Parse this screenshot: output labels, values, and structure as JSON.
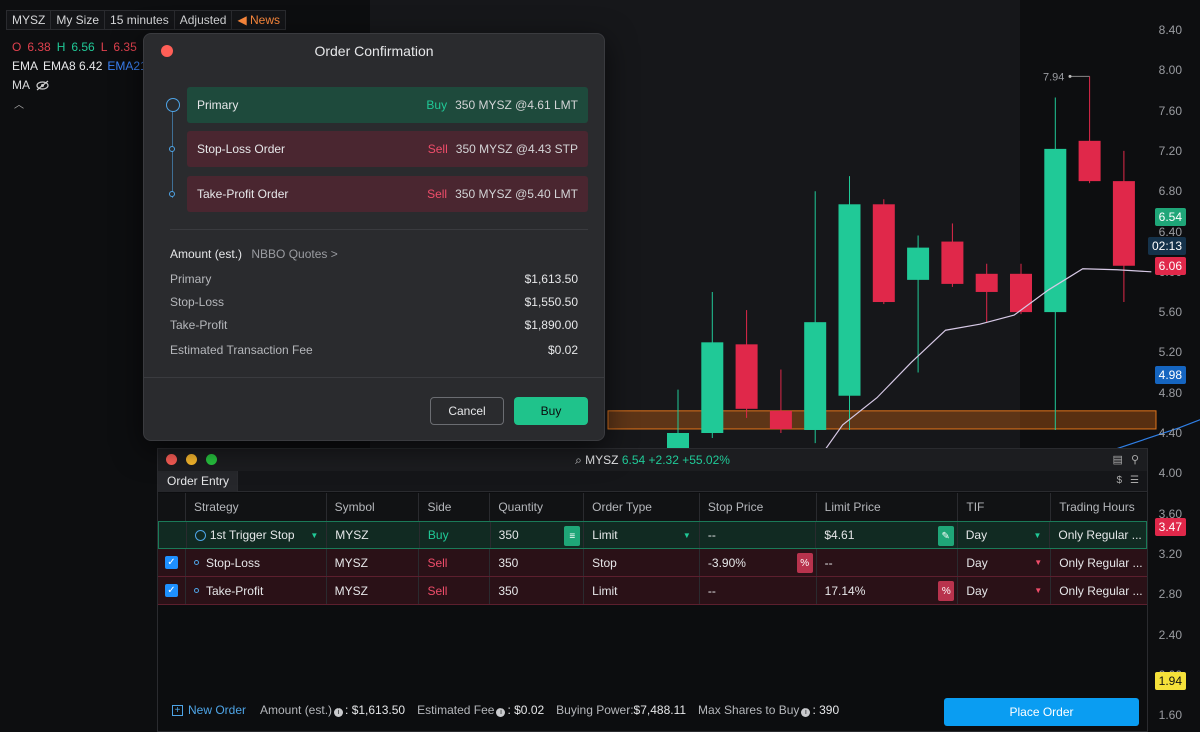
{
  "toolbar": {
    "symbol": "MYSZ",
    "size": "My Size",
    "interval": "15 minutes",
    "adjust": "Adjusted",
    "news": "News"
  },
  "ohlc": {
    "o_label": "O",
    "o": "6.38",
    "h_label": "H",
    "h": "6.56",
    "l_label": "L",
    "l": "6.35"
  },
  "studies": {
    "ema_label": "EMA",
    "ema8": "EMA8 6.42",
    "ema21": "EMA21",
    "ma_label": "MA"
  },
  "colors": {
    "up": "#20c997",
    "down": "#e0284a",
    "accent": "#0a9df2",
    "ema8": "#d7c9e6",
    "ema21": "#2f7fe6"
  },
  "y_axis": {
    "ticks": [
      "8.40",
      "8.00",
      "7.60",
      "7.20",
      "6.80",
      "6.40",
      "6.00",
      "5.60",
      "5.20",
      "4.80",
      "4.40",
      "4.00",
      "3.60",
      "3.20",
      "2.80",
      "2.40",
      "2.00",
      "1.60"
    ],
    "tags": [
      {
        "text": "6.54",
        "bg": "#1fa678",
        "fg": "#ffffff"
      },
      {
        "text": "02:13",
        "bg": "#15324a",
        "fg": "#ffffff"
      },
      {
        "text": "6.06",
        "bg": "#e0284a",
        "fg": "#ffffff"
      },
      {
        "text": "4.98",
        "bg": "#1565c0",
        "fg": "#ffffff"
      },
      {
        "text": "3.47",
        "bg": "#e0284a",
        "fg": "#ffffff"
      },
      {
        "text": "1.94",
        "bg": "#f5e13a",
        "fg": "#111111"
      }
    ],
    "high_marker": "7.94"
  },
  "candles": [
    {
      "o": 3.47,
      "c": 4.4,
      "h": 4.83,
      "l": 3.4
    },
    {
      "o": 4.4,
      "c": 5.3,
      "h": 5.8,
      "l": 4.35
    },
    {
      "o": 5.28,
      "c": 4.64,
      "h": 5.62,
      "l": 4.55
    },
    {
      "o": 4.62,
      "c": 4.44,
      "h": 5.03,
      "l": 4.4
    },
    {
      "o": 4.43,
      "c": 5.5,
      "h": 6.8,
      "l": 4.3
    },
    {
      "o": 4.77,
      "c": 6.67,
      "h": 6.95,
      "l": 4.43
    },
    {
      "o": 6.67,
      "c": 5.7,
      "h": 6.72,
      "l": 5.68
    },
    {
      "o": 5.92,
      "c": 6.24,
      "h": 6.36,
      "l": 5.0
    },
    {
      "o": 6.3,
      "c": 5.88,
      "h": 6.48,
      "l": 5.85
    },
    {
      "o": 5.98,
      "c": 5.8,
      "h": 6.08,
      "l": 5.5
    },
    {
      "o": 5.98,
      "c": 5.6,
      "h": 6.08,
      "l": 5.58
    },
    {
      "o": 5.6,
      "c": 7.22,
      "h": 7.73,
      "l": 4.43
    },
    {
      "o": 7.3,
      "c": 6.9,
      "h": 7.94,
      "l": 6.88
    },
    {
      "o": 6.9,
      "c": 6.06,
      "h": 7.2,
      "l": 5.7
    }
  ],
  "ema8_line": [
    3.62,
    4.0,
    4.48,
    4.75,
    5.1,
    5.42,
    5.48,
    5.57,
    5.82,
    6.03,
    6.02,
    6.0
  ],
  "ema21_line": [
    3.1,
    3.55,
    4.2,
    4.45,
    4.74,
    4.98
  ],
  "dialog": {
    "title": "Order Confirmation",
    "legs": [
      {
        "name": "Primary",
        "side": "Buy",
        "desc": "350 MYSZ @4.61 LMT"
      },
      {
        "name": "Stop-Loss Order",
        "side": "Sell",
        "desc": "350 MYSZ @4.43 STP"
      },
      {
        "name": "Take-Profit Order",
        "side": "Sell",
        "desc": "350 MYSZ @5.40 LMT"
      }
    ],
    "amount_label": "Amount (est.)",
    "quotes_link": "NBBO Quotes >",
    "amounts": [
      {
        "label": "Primary",
        "value": "$1,613.50"
      },
      {
        "label": "Stop-Loss",
        "value": "$1,550.50"
      },
      {
        "label": "Take-Profit",
        "value": "$1,890.00"
      },
      {
        "label": "Estimated Transaction Fee",
        "value": "$0.02"
      }
    ],
    "cancel": "Cancel",
    "confirm": "Buy"
  },
  "entry": {
    "quote_symbol": "MYSZ",
    "quote_change": "6.54 +2.32 +55.02%",
    "tab": "Order Entry",
    "columns": [
      "Strategy",
      "Symbol",
      "Side",
      "Quantity",
      "Order Type",
      "Stop Price",
      "Limit Price",
      "TIF",
      "Trading Hours"
    ],
    "rows": [
      {
        "strategy": "1st Trigger Stop",
        "symbol": "MYSZ",
        "side": "Buy",
        "qty": "350",
        "type": "Limit",
        "stop": "--",
        "limit": "$4.61",
        "tif": "Day",
        "hours": "Only Regular ..."
      },
      {
        "strategy": "Stop-Loss",
        "symbol": "MYSZ",
        "side": "Sell",
        "qty": "350",
        "type": "Stop",
        "stop": "-3.90%",
        "limit": "--",
        "tif": "Day",
        "hours": "Only Regular ..."
      },
      {
        "strategy": "Take-Profit",
        "symbol": "MYSZ",
        "side": "Sell",
        "qty": "350",
        "type": "Limit",
        "stop": "--",
        "limit": "17.14%",
        "tif": "Day",
        "hours": "Only Regular ..."
      }
    ],
    "footer": {
      "new_order": "New Order",
      "amount_label": "Amount (est.)",
      "amount": ": $1,613.50",
      "fee_label": "Estimated Fee",
      "fee": ": $0.02",
      "bp_label": "Buying Power:",
      "bp": "$7,488.11",
      "max_label": "Max Shares to Buy",
      "max": ": 390",
      "place": "Place Order"
    }
  }
}
